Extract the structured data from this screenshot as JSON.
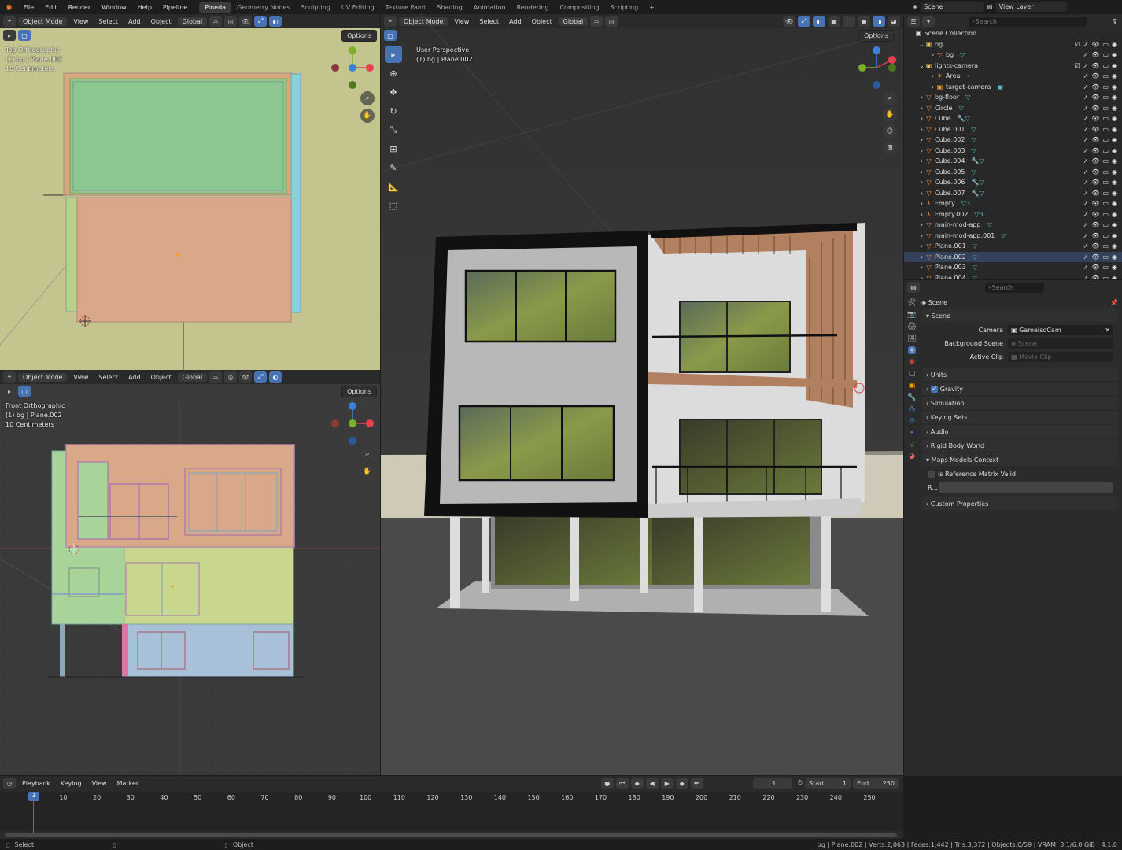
{
  "menubar": {
    "items": [
      "File",
      "Edit",
      "Render",
      "Window",
      "Help",
      "Pipeline"
    ],
    "workspaces": [
      "Pineda",
      "Geometry Nodes",
      "Sculpting",
      "UV Editing",
      "Texture Paint",
      "Shading",
      "Animation",
      "Rendering",
      "Compositing",
      "Scripting"
    ],
    "active_workspace": "Pineda",
    "add_tab": "+",
    "scene_label": "Scene",
    "view_layer_label": "View Layer"
  },
  "viewport_header": {
    "mode": "Object Mode",
    "menus": [
      "View",
      "Select",
      "Add",
      "Object"
    ],
    "orientation": "Global",
    "options": "Options"
  },
  "top_view": {
    "title": "Top Orthographic",
    "subtitle": "(1) bg | Plane.002",
    "scale": "10 Centimeters"
  },
  "front_view": {
    "title": "Front Orthographic",
    "subtitle": "(1) bg | Plane.002",
    "scale": "10 Centimeters"
  },
  "persp_view": {
    "title": "User Perspective",
    "subtitle": "(1) bg | Plane.002"
  },
  "gizmo": {
    "x": "X",
    "y": "Y",
    "z": "Z",
    "x_color": "#e64050",
    "y_color": "#7ab32a",
    "z_color": "#3d80d8"
  },
  "outliner": {
    "search_placeholder": "Search",
    "root": "Scene Collection",
    "rows": [
      {
        "name": "bg",
        "icon": "collection-icon",
        "level": 1,
        "expanded": true,
        "check": true
      },
      {
        "name": "bg",
        "icon": "mesh-icon",
        "level": 2,
        "extra": "▽"
      },
      {
        "name": "lights-camera",
        "icon": "collection-icon",
        "level": 1,
        "expanded": true,
        "check": true
      },
      {
        "name": "Area",
        "icon": "light-icon",
        "level": 2,
        "extra": "∘"
      },
      {
        "name": "target-camera",
        "icon": "camera-icon",
        "level": 2,
        "extra": "▣"
      },
      {
        "name": "bg-floor",
        "icon": "mesh-icon",
        "level": 1,
        "extra": "▽"
      },
      {
        "name": "Circle",
        "icon": "mesh-icon",
        "level": 1,
        "extra": "▽"
      },
      {
        "name": "Cube",
        "icon": "mesh-icon",
        "level": 1,
        "extra": "🔧▽"
      },
      {
        "name": "Cube.001",
        "icon": "mesh-icon",
        "level": 1,
        "extra": "▽"
      },
      {
        "name": "Cube.002",
        "icon": "mesh-icon",
        "level": 1,
        "extra": "▽"
      },
      {
        "name": "Cube.003",
        "icon": "mesh-icon",
        "level": 1,
        "extra": "▽"
      },
      {
        "name": "Cube.004",
        "icon": "mesh-icon",
        "level": 1,
        "extra": "🔧▽"
      },
      {
        "name": "Cube.005",
        "icon": "mesh-icon",
        "level": 1,
        "extra": "▽"
      },
      {
        "name": "Cube.006",
        "icon": "mesh-icon",
        "level": 1,
        "extra": "🔧▽"
      },
      {
        "name": "Cube.007",
        "icon": "mesh-icon",
        "level": 1,
        "extra": "🔧▽"
      },
      {
        "name": "Empty",
        "icon": "empty-icon",
        "level": 1,
        "extra": "▽3"
      },
      {
        "name": "Empty.002",
        "icon": "empty-icon",
        "level": 1,
        "extra": "▽3"
      },
      {
        "name": "main-mod-app",
        "icon": "mesh-icon",
        "level": 1,
        "extra": "▽"
      },
      {
        "name": "main-mod-app.001",
        "icon": "mesh-icon",
        "level": 1,
        "extra": "▽"
      },
      {
        "name": "Plane.001",
        "icon": "mesh-icon",
        "level": 1,
        "extra": "▽"
      },
      {
        "name": "Plane.002",
        "icon": "mesh-icon",
        "level": 1,
        "extra": "▽"
      },
      {
        "name": "Plane.003",
        "icon": "mesh-icon",
        "level": 1,
        "extra": "▽"
      },
      {
        "name": "Plane.004",
        "icon": "mesh-icon",
        "level": 1,
        "extra": "▽"
      }
    ]
  },
  "properties": {
    "search_placeholder": "Search",
    "context": "Scene",
    "scene_panel": "Scene",
    "camera_label": "Camera",
    "camera_value": "GameIsoCam",
    "bg_scene_label": "Background Scene",
    "bg_scene_placeholder": "Scene",
    "active_clip_label": "Active Clip",
    "active_clip_placeholder": "Movie Clip",
    "panels": [
      "Units",
      "Gravity",
      "Simulation",
      "Keying Sets",
      "Audio",
      "Rigid Body World",
      "Maps Models Context"
    ],
    "gravity_checked": true,
    "ref_matrix_label": "Is Reference Matrix Valid",
    "r_label": "R...",
    "custom_props": "Custom Properties"
  },
  "timeline": {
    "menus": [
      "Playback",
      "Keying",
      "View",
      "Marker"
    ],
    "current_frame": "1",
    "start_label": "Start",
    "start_value": "1",
    "end_label": "End",
    "end_value": "250",
    "ticks": [
      "1",
      "10",
      "20",
      "30",
      "40",
      "50",
      "60",
      "70",
      "80",
      "90",
      "100",
      "110",
      "120",
      "130",
      "140",
      "150",
      "160",
      "170",
      "180",
      "190",
      "200",
      "210",
      "220",
      "230",
      "240",
      "250"
    ]
  },
  "statusbar": {
    "left": "Select",
    "mid": "Object",
    "right": "bg | Plane.002 | Verts:2,063 | Faces:1,442 | Tris:3,372 | Objects:0/59 | VRAM: 3.1/6.0 GiB | 4.1.0"
  }
}
